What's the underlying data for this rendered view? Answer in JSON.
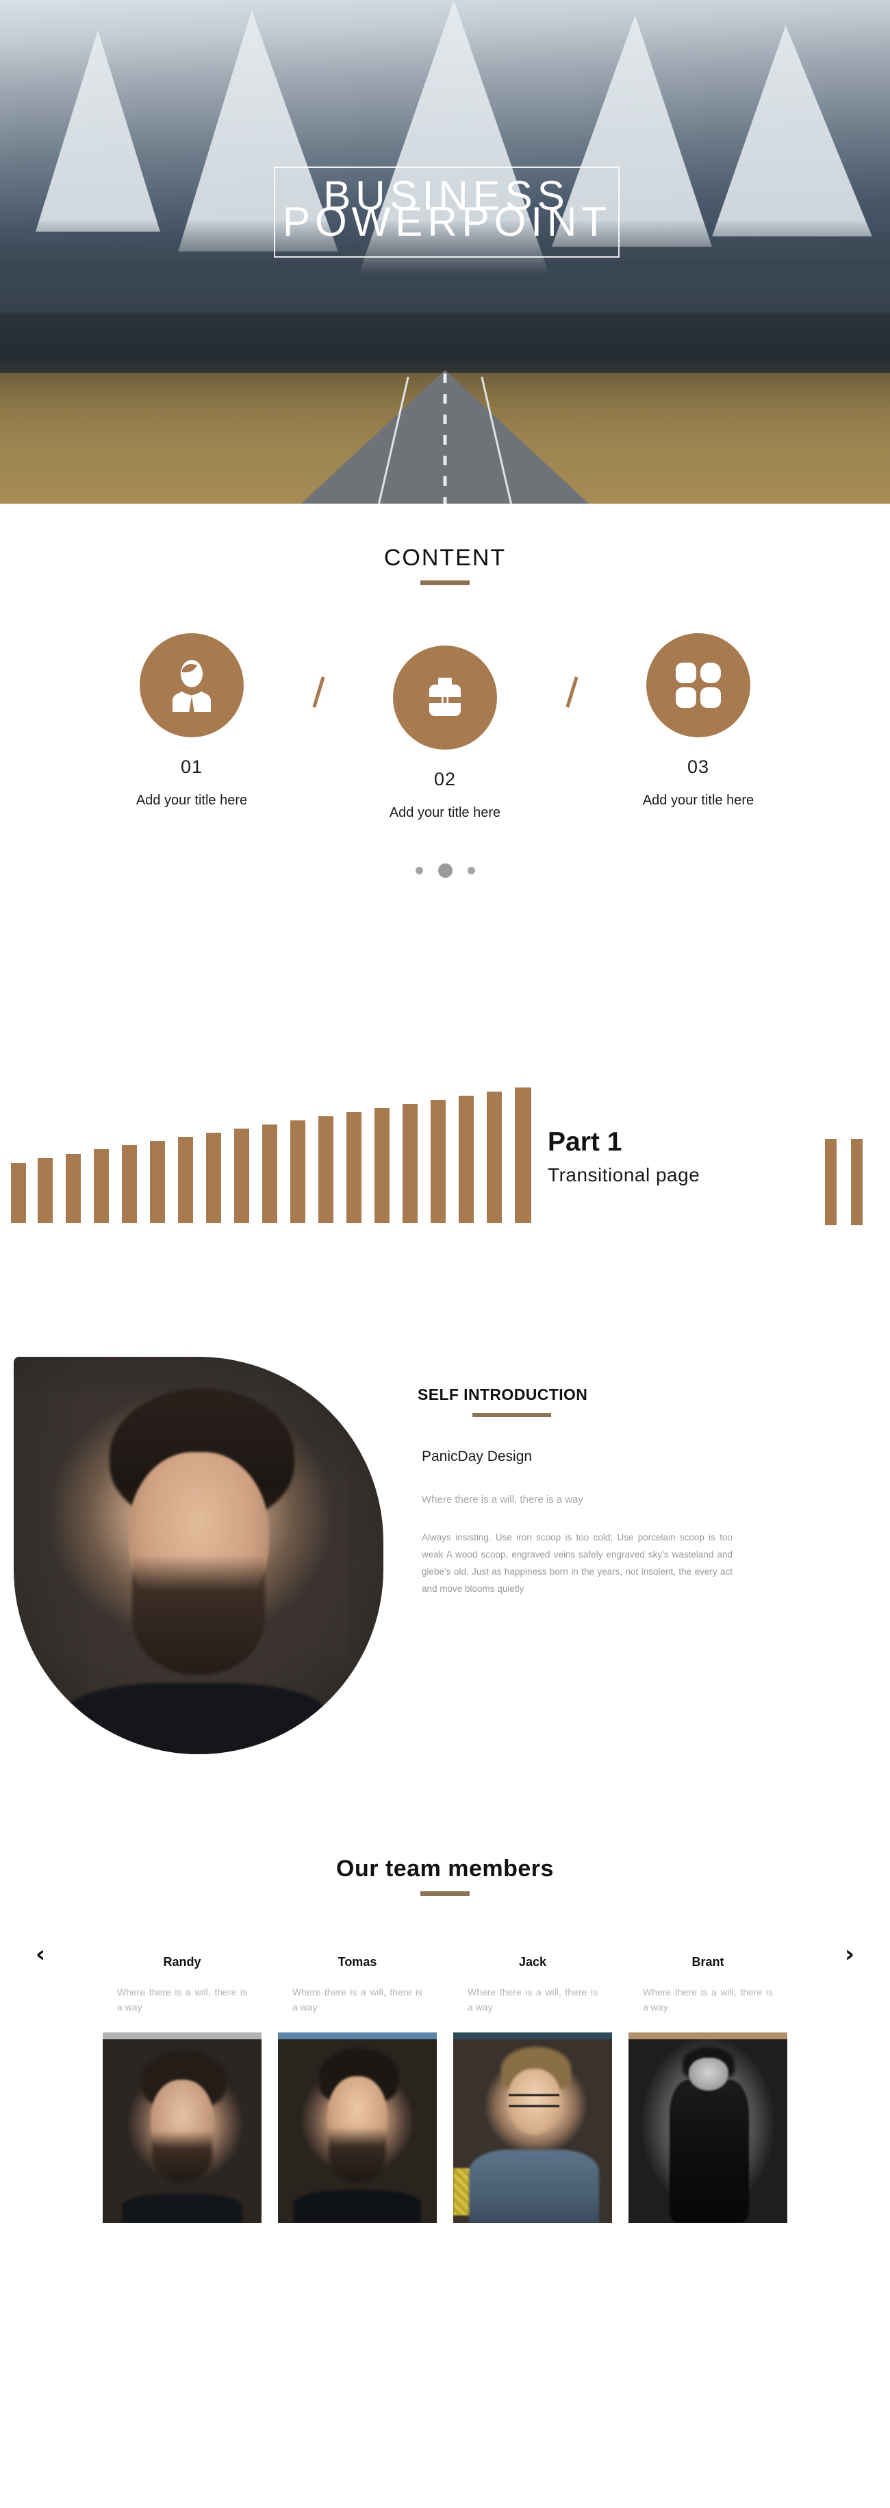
{
  "hero": {
    "title_line_1": "BUSINESS",
    "title_line_2": "POWERPOINT"
  },
  "content": {
    "heading": "CONTENT",
    "separator_symbol": "/",
    "items": [
      {
        "number": "01",
        "title": "Add your title here",
        "icon": "businessman-icon"
      },
      {
        "number": "02",
        "title": "Add your title here",
        "icon": "briefcase-icon"
      },
      {
        "number": "03",
        "title": "Add your title here",
        "icon": "grid-four-icon"
      }
    ],
    "pagination": {
      "total": 3,
      "active_index": 1
    }
  },
  "transition": {
    "title": "Part 1",
    "subtitle": "Transitional  page",
    "accent_color": "#a87a50"
  },
  "self_introduction": {
    "heading": "SELF INTRODUCTION",
    "name": "PanicDay Design",
    "motto": "Where there is a will, there is a way",
    "body": "Always insisting. Use iron scoop is too cold; Use porcelain scoop is too weak A wood scoop, engraved veins safely engraved sky’s wasteland and glebe’s old. Just as happiness born in the years, not insolent, the every act and move blooms quietly"
  },
  "team": {
    "heading": "Our team members",
    "prev_arrow": "‹",
    "next_arrow": "›",
    "members": [
      {
        "name": "Randy",
        "quote": "Where there is a will, there is a way",
        "bar_color": "#b3b3b3"
      },
      {
        "name": "Tomas",
        "quote": "Where there is a will, there is a way",
        "bar_color": "#5b87a8"
      },
      {
        "name": "Jack",
        "quote": "Where there is a will, there is a way",
        "bar_color": "#2a4a57"
      },
      {
        "name": "Brant",
        "quote": "Where there is a will, there is a way",
        "bar_color": "#b2906b"
      }
    ]
  },
  "theme": {
    "accent_brown": "#a87a50",
    "rule_brown": "#8d7554",
    "text_dark": "#111111",
    "text_muted": "#9a9a9a"
  }
}
